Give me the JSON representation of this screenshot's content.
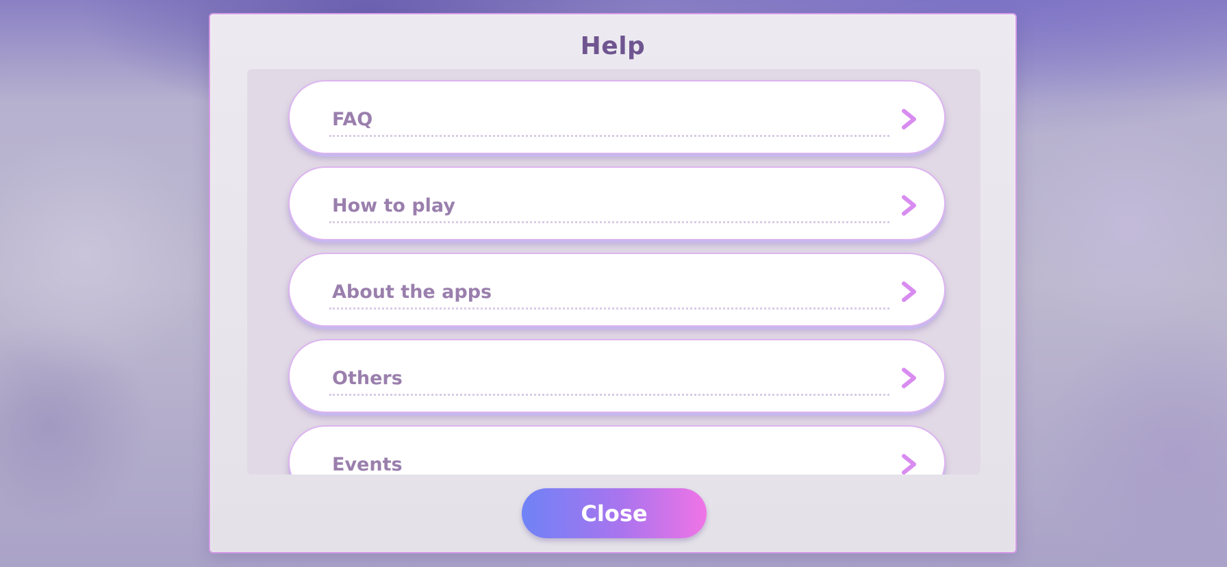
{
  "dialog": {
    "title": "Help",
    "close_label": "Close"
  },
  "menu": {
    "items": [
      {
        "label": "FAQ",
        "icon": "chevron-right-icon"
      },
      {
        "label": "How to play",
        "icon": "chevron-right-icon"
      },
      {
        "label": "About the apps",
        "icon": "chevron-right-icon"
      },
      {
        "label": "Others",
        "icon": "chevron-right-icon"
      },
      {
        "label": "Events",
        "icon": "chevron-right-icon"
      }
    ]
  },
  "colors": {
    "title": "#6f5590",
    "item_text": "#9a7fad",
    "accent_chevron": "#d88cf0",
    "button_gradient_start": "#6f82f6",
    "button_gradient_end": "#f074e6"
  }
}
